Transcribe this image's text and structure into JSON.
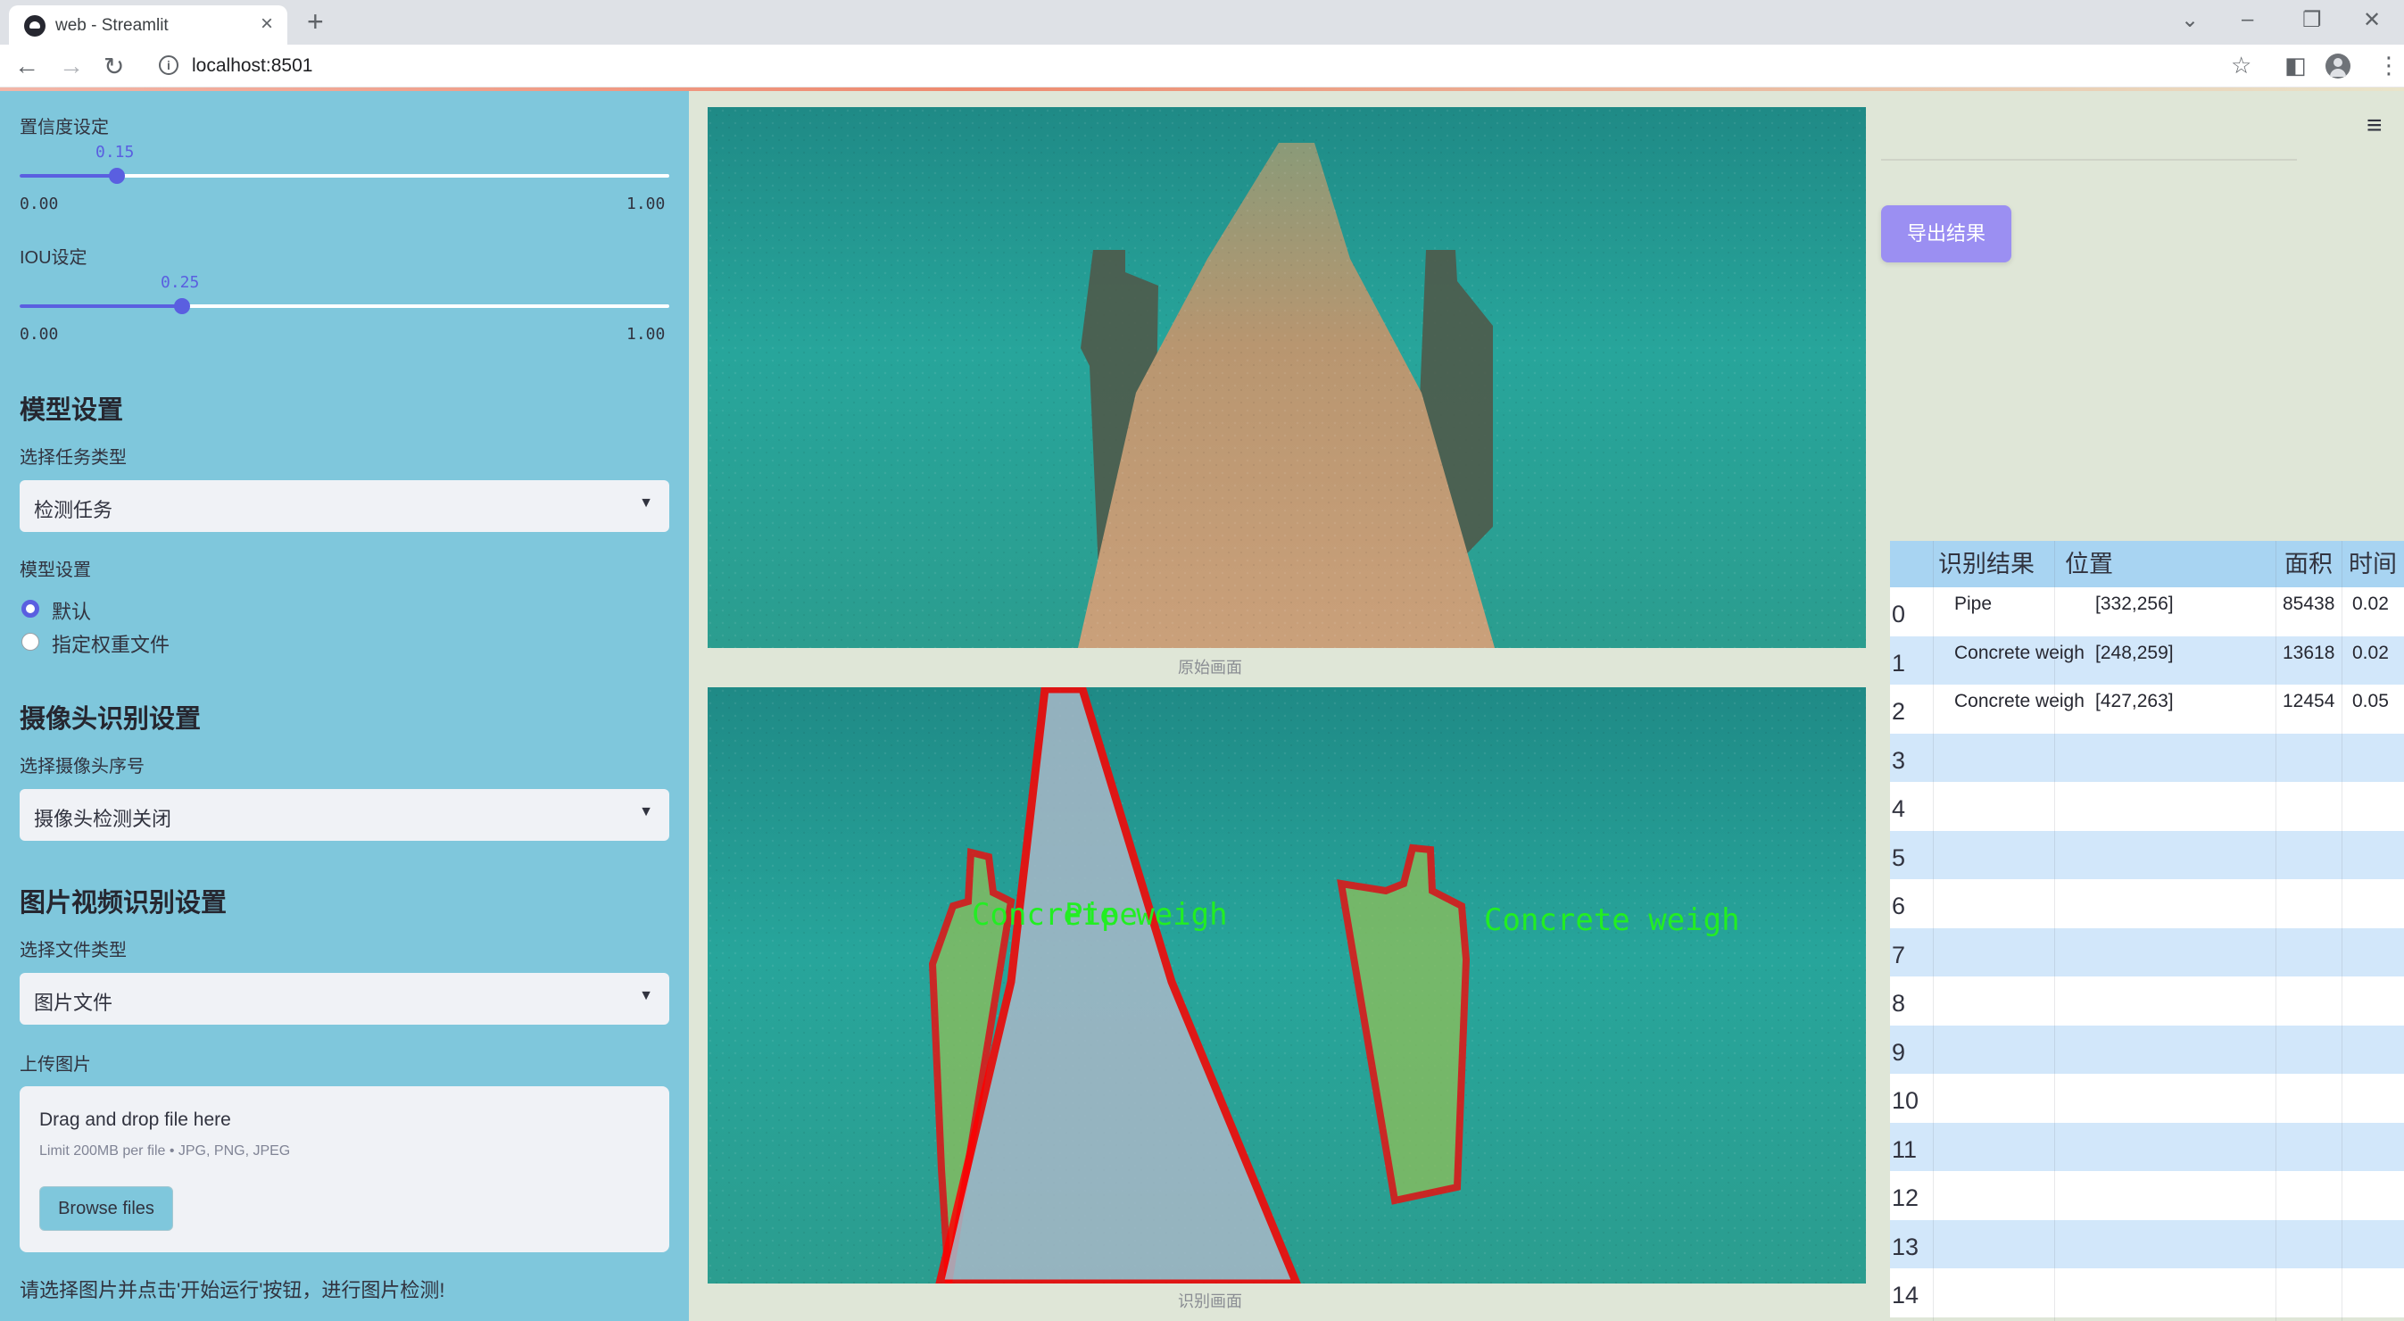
{
  "browser": {
    "tab_title": "web - Streamlit",
    "url": "localhost:8501"
  },
  "sidebar": {
    "confidence": {
      "label": "置信度设定",
      "value": 0.15,
      "value_text": "0.15",
      "min": "0.00",
      "max": "1.00"
    },
    "iou": {
      "label": "IOU设定",
      "value": 0.25,
      "value_text": "0.25",
      "min": "0.00",
      "max": "1.00"
    },
    "model_section": "模型设置",
    "task_type_label": "选择任务类型",
    "task_type_value": "检测任务",
    "model_setting_label": "模型设置",
    "radio_default": "默认",
    "radio_custom": "指定权重文件",
    "camera_section": "摄像头识别设置",
    "camera_label": "选择摄像头序号",
    "camera_value": "摄像头检测关闭",
    "media_section": "图片视频识别设置",
    "file_type_label": "选择文件类型",
    "file_type_value": "图片文件",
    "upload_label": "上传图片",
    "upload_title": "Drag and drop file here",
    "upload_limit": "Limit 200MB per file • JPG, PNG, JPEG",
    "browse_button": "Browse files",
    "hint": "请选择图片并点击'开始运行'按钮，进行图片检测!"
  },
  "main": {
    "original_caption": "原始画面",
    "detected_caption": "识别画面",
    "overlay_labels": [
      "Concrete weigh",
      "Pipe",
      "Concrete weigh"
    ]
  },
  "right": {
    "export_button": "导出结果",
    "table": {
      "headers": [
        "识别结果",
        "位置",
        "面积",
        "时间"
      ],
      "rows": [
        {
          "index": "0",
          "result": "Pipe",
          "position": "[332,256]",
          "area": "85438",
          "time": "0.02"
        },
        {
          "index": "1",
          "result": "Concrete weigh",
          "position": "[248,259]",
          "area": "13618",
          "time": "0.02"
        },
        {
          "index": "2",
          "result": "Concrete weigh",
          "position": "[427,263]",
          "area": "12454",
          "time": "0.05"
        },
        {
          "index": "3"
        },
        {
          "index": "4"
        },
        {
          "index": "5"
        },
        {
          "index": "6"
        },
        {
          "index": "7"
        },
        {
          "index": "8"
        },
        {
          "index": "9"
        },
        {
          "index": "10"
        },
        {
          "index": "11"
        },
        {
          "index": "12"
        },
        {
          "index": "13"
        },
        {
          "index": "14"
        }
      ]
    }
  },
  "colors": {
    "sidebar_bg": "#7fc7dc",
    "main_bg": "#dfe6d7",
    "accent": "#5a5fe0",
    "export_button": "#9b8ff2",
    "detection_outline": "#ff0000",
    "detection_label": "#22ee22"
  }
}
